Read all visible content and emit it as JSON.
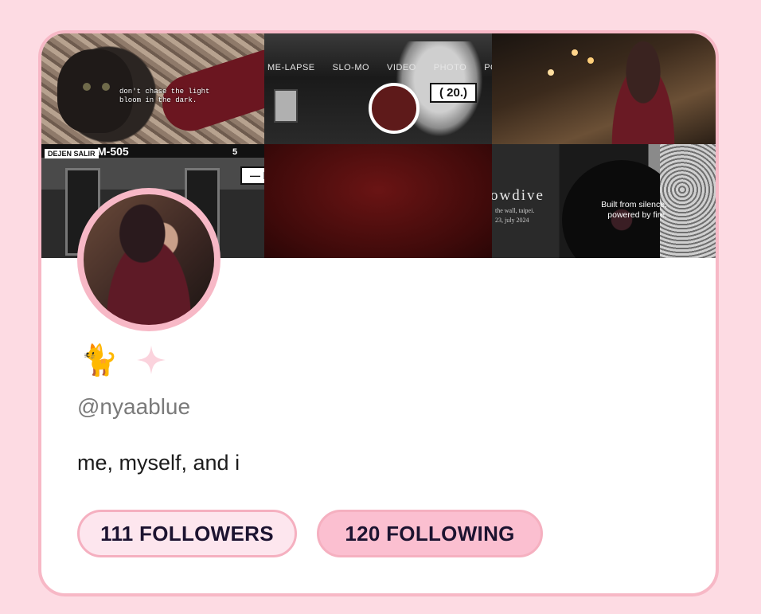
{
  "banner": {
    "cat_caption_line1": "don't chase the light",
    "cat_caption_line2": "bloom in the dark.",
    "camera_modes": [
      "ME-LAPSE",
      "SLO-MO",
      "VIDEO",
      "PHOTO",
      "PO"
    ],
    "camera_label": "( 20.)",
    "station_sign": "DEJEN SALIR",
    "train_number": "M-505",
    "train_door_number": "5",
    "r_label": "— R",
    "band_name": "owdive",
    "band_sub_line1": "the wall, taipei.",
    "band_sub_line2": "23, july 2024",
    "vinyl_quote_line1": "Built from silence,",
    "vinyl_quote_line2": "powered by fire."
  },
  "profile": {
    "cat_emoji": "🐈",
    "handle": "@nyaablue",
    "bio": "me, myself, and i"
  },
  "stats": {
    "followers_label": "111 FOLLOWERS",
    "following_label": "120 FOLLOWING"
  },
  "colors": {
    "page_background": "#fddbe3",
    "card_border": "#f7b8c6",
    "followers_pill_bg": "#fde6ee",
    "following_pill_bg": "#fbbfd0"
  }
}
